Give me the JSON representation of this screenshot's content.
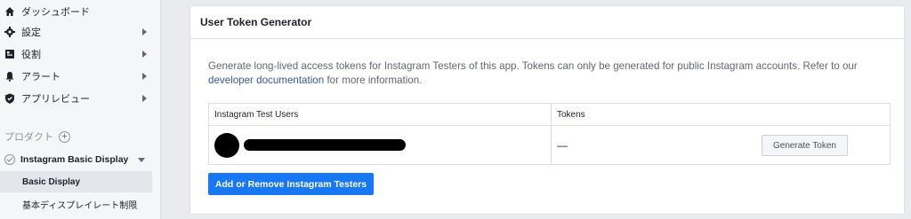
{
  "sidebar": {
    "items": [
      {
        "label": "ダッシュボード",
        "icon": "home-icon",
        "has_caret": false
      },
      {
        "label": "設定",
        "icon": "gear-icon",
        "has_caret": true
      },
      {
        "label": "役割",
        "icon": "roles-icon",
        "has_caret": true
      },
      {
        "label": "アラート",
        "icon": "bell-icon",
        "has_caret": true
      },
      {
        "label": "アプリレビュー",
        "icon": "shield-icon",
        "has_caret": true
      }
    ],
    "products_label": "プロダクト",
    "product": {
      "label": "Instagram Basic Display",
      "icon": "check-circle-icon"
    },
    "sub_items": [
      {
        "label": "Basic Display",
        "active": true
      },
      {
        "label": "基本ディスプレイレート制限",
        "active": false
      }
    ]
  },
  "card": {
    "title": "User Token Generator",
    "description_prefix": "Generate long-lived access tokens for Instagram Testers of this app. Tokens can only be generated for public Instagram accounts. Refer to our",
    "description_link": "developer documentation",
    "description_suffix": "for more information.",
    "table": {
      "headers": [
        "Instagram Test Users",
        "Tokens"
      ],
      "rows": [
        {
          "token": "—",
          "button": "Generate Token"
        }
      ]
    },
    "add_button": "Add or Remove Instagram Testers"
  },
  "colors": {
    "accent": "#1877f2",
    "link": "#385898"
  }
}
